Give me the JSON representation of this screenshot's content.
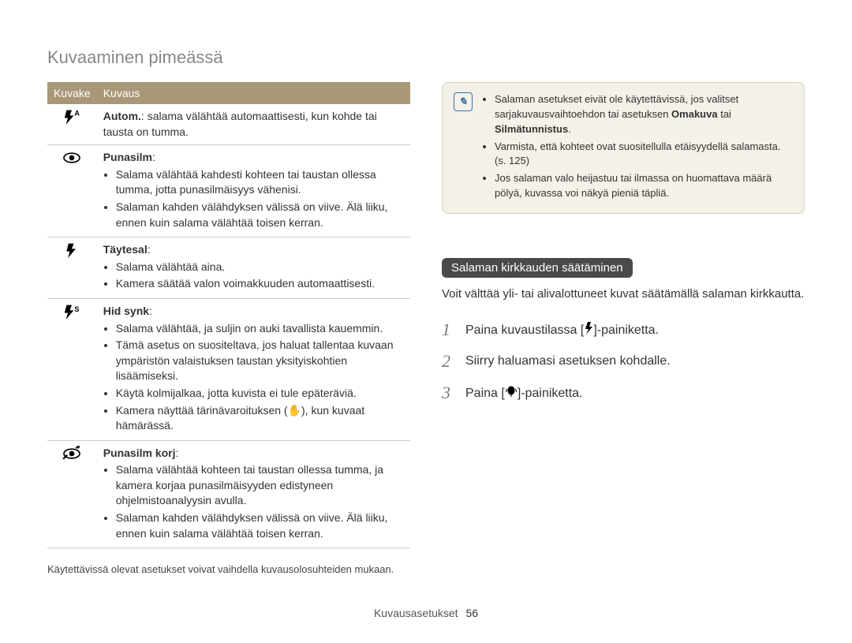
{
  "page_title": "Kuvaaminen pimeässä",
  "table": {
    "headers": {
      "icon": "Kuvake",
      "desc": "Kuvaus"
    },
    "rows": [
      {
        "icon_name": "flash-auto-icon",
        "title": "Autom.",
        "title_suffix": ": salama välähtää automaattisesti, kun kohde tai tausta on tumma."
      },
      {
        "icon_name": "red-eye-icon",
        "title": "Punasilm",
        "title_suffix": ":",
        "bullets": [
          "Salama välähtää kahdesti kohteen tai taustan ollessa tumma, jotta punasilmäisyys vähenisi.",
          "Salaman kahden välähdyksen välissä on viive. Älä liiku, ennen kuin salama välähtää toisen kerran."
        ]
      },
      {
        "icon_name": "flash-fill-icon",
        "title": "Täytesal",
        "title_suffix": ":",
        "bullets": [
          "Salama välähtää aina.",
          "Kamera säätää valon voimakkuuden automaattisesti."
        ]
      },
      {
        "icon_name": "flash-slow-sync-icon",
        "title": "Hid synk",
        "title_suffix": ":",
        "bullets": [
          "Salama välähtää, ja suljin on auki tavallista kauemmin.",
          "Tämä asetus on suositeltava, jos haluat tallentaa kuvaan ympäristön valaistuksen taustan yksityiskohtien lisäämiseksi.",
          "Käytä kolmijalkaa, jotta kuvista ei tule epäteräviä.",
          "Kamera näyttää tärinävaroituksen (✋), kun kuvaat hämärässä."
        ]
      },
      {
        "icon_name": "red-eye-fix-icon",
        "title": "Punasilm korj",
        "title_suffix": ":",
        "bullets": [
          "Salama välähtää kohteen tai taustan ollessa tumma, ja kamera korjaa punasilmäisyyden edistyneen ohjelmistoanalyysin avulla.",
          "Salaman kahden välähdyksen välissä on viive. Älä liiku, ennen kuin salama välähtää toisen kerran."
        ]
      }
    ],
    "footnote": "Käytettävissä olevat asetukset voivat vaihdella kuvausolosuhteiden mukaan."
  },
  "note_box": {
    "bullets_pre": "Salaman asetukset eivät ole käytettävissä, jos valitset sarjakuvausvaihtoehdon tai asetuksen ",
    "bold1": "Omakuva",
    "mid": " tai ",
    "bold2": "Silmätunnistus",
    "bullets_rest": [
      "Varmista, että kohteet ovat suositellulla etäisyydellä salamasta. (s. 125)",
      "Jos salaman valo heijastuu tai ilmassa on huomattava määrä pölyä, kuvassa voi näkyä pieniä täpliä."
    ]
  },
  "section": {
    "heading": "Salaman kirkkauden säätäminen",
    "desc": "Voit välttää yli- tai alivalottuneet kuvat säätämällä salaman kirkkautta.",
    "steps": [
      {
        "n": "1",
        "pre": "Paina kuvaustilassa [",
        "icon": "flash-icon",
        "post": "]-painiketta."
      },
      {
        "n": "2",
        "text": "Siirry haluamasi asetuksen kohdalle."
      },
      {
        "n": "3",
        "pre": "Paina [",
        "icon": "macro-icon",
        "post": "]-painiketta."
      }
    ]
  },
  "footer": {
    "label": "Kuvausasetukset",
    "page": "56"
  }
}
